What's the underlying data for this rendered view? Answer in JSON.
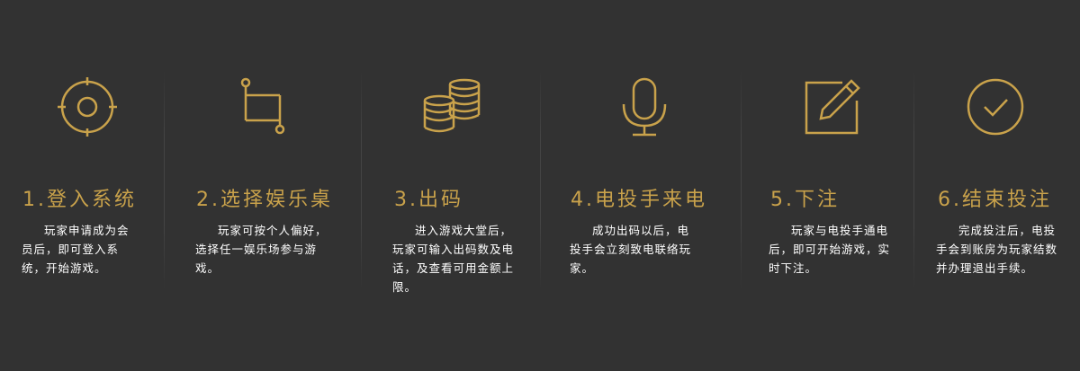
{
  "accent_color": "#c9a24b",
  "background_color": "#323232",
  "steps": [
    {
      "icon": "target-icon",
      "title": "1.登入系统",
      "description": "玩家申请成为会员后，即可登入系统，开始游戏。"
    },
    {
      "icon": "crop-icon",
      "title": "2.选择娱乐桌",
      "description": "玩家可按个人偏好，选择任一娱乐场参与游戏。"
    },
    {
      "icon": "coins-icon",
      "title": "3.出码",
      "description": "进入游戏大堂后，玩家可输入出码数及电话，及查看可用金额上限。"
    },
    {
      "icon": "microphone-icon",
      "title": "4.电投手来电",
      "description": "成功出码以后，电投手会立刻致电联络玩家。"
    },
    {
      "icon": "edit-icon",
      "title": "5.下注",
      "description": "玩家与电投手通电后，即可开始游戏，实时下注。"
    },
    {
      "icon": "check-circle-icon",
      "title": "6.结束投注",
      "description": "完成投注后，电投手会到账房为玩家结数并办理退出手续。"
    }
  ]
}
